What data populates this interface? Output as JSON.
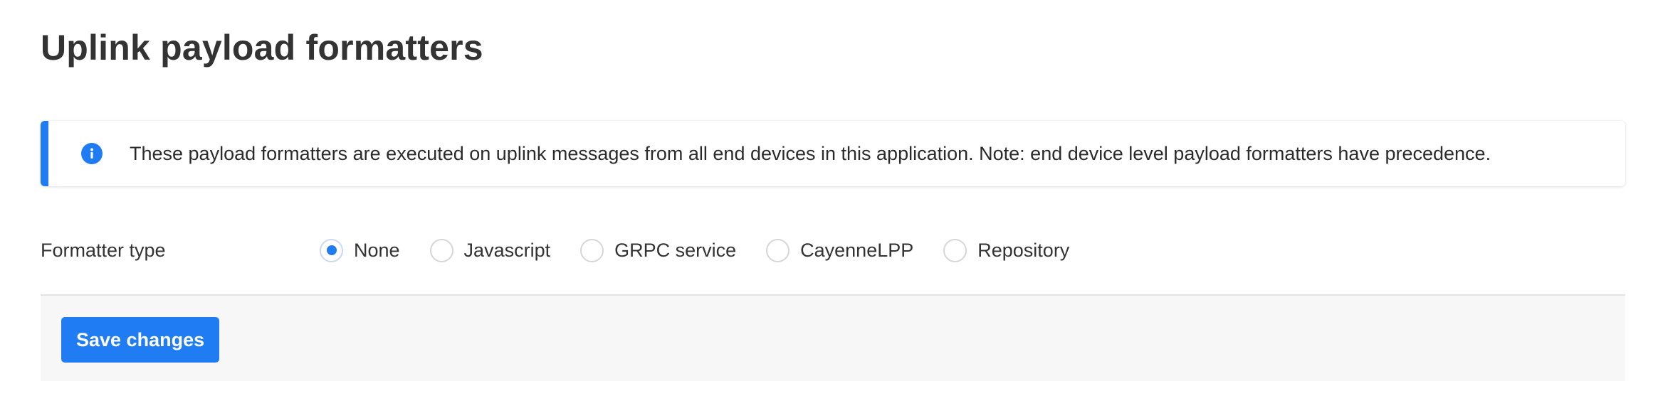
{
  "page": {
    "title": "Uplink payload formatters"
  },
  "notice": {
    "icon": "info-icon",
    "text": "These payload formatters are executed on uplink messages from all end devices in this application. Note: end device level payload formatters have precedence."
  },
  "form": {
    "formatter_type_label": "Formatter type",
    "options": [
      {
        "label": "None",
        "selected": true
      },
      {
        "label": "Javascript",
        "selected": false
      },
      {
        "label": "GRPC service",
        "selected": false
      },
      {
        "label": "CayenneLPP",
        "selected": false
      },
      {
        "label": "Repository",
        "selected": false
      }
    ]
  },
  "footer": {
    "save_label": "Save changes"
  },
  "colors": {
    "accent": "#1f7cf2",
    "footer_bg": "#f7f7f7"
  }
}
